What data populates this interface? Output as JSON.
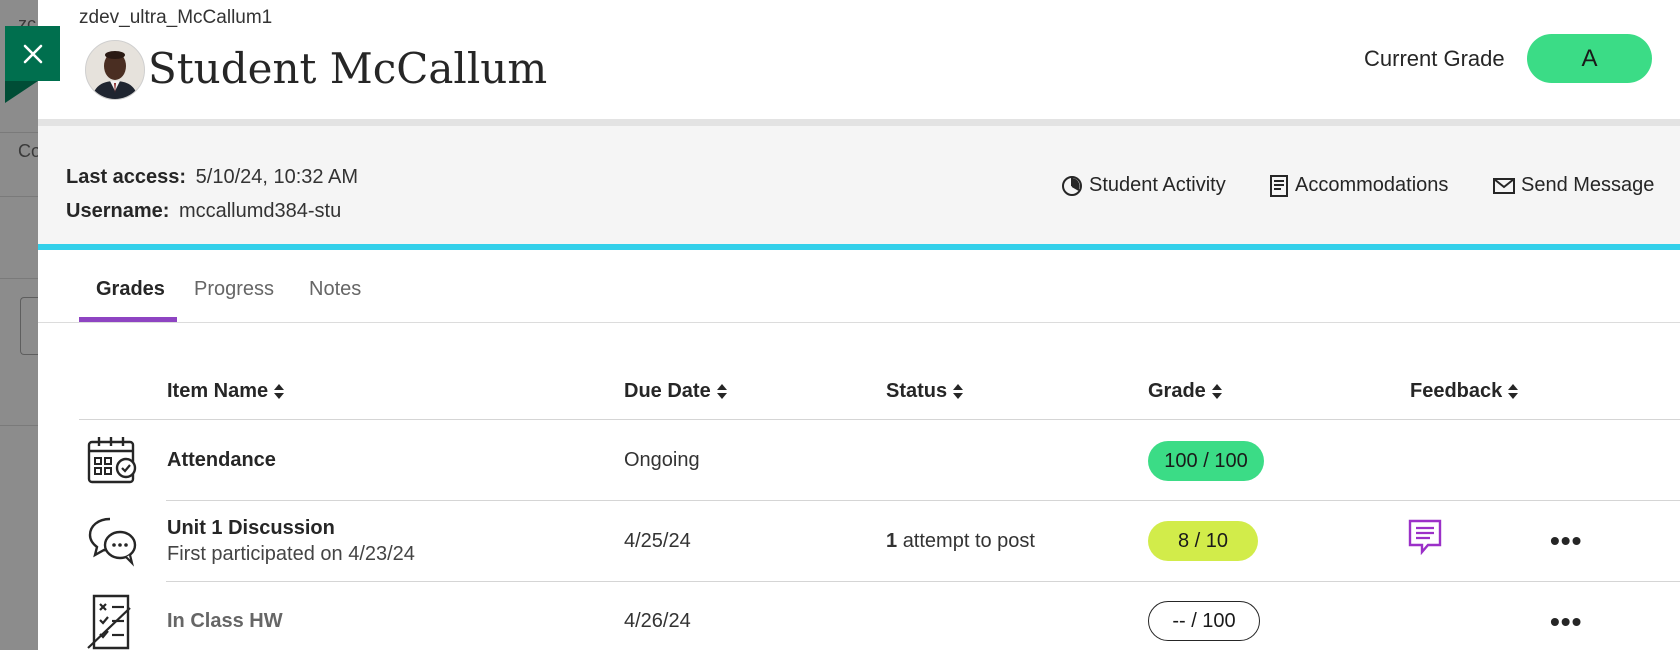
{
  "background": {
    "fragment_top": "zc",
    "fragment_mid": "Co"
  },
  "header": {
    "course_id": "zdev_ultra_McCallum1",
    "student_name": "Student McCallum",
    "current_grade_label": "Current Grade",
    "current_grade": "A"
  },
  "info": {
    "last_access_label": "Last access:",
    "last_access_value": "5/10/24, 10:32 AM",
    "username_label": "Username:",
    "username_value": "mccallumd384-stu"
  },
  "actions": {
    "student_activity": "Student Activity",
    "accommodations": "Accommodations",
    "send_message": "Send Message"
  },
  "tabs": {
    "grades": "Grades",
    "progress": "Progress",
    "notes": "Notes"
  },
  "columns": {
    "item_name": "Item Name",
    "due_date": "Due Date",
    "status": "Status",
    "grade": "Grade",
    "feedback": "Feedback"
  },
  "rows": [
    {
      "title": "Attendance",
      "subtitle": "",
      "due": "Ongoing",
      "status_count": "",
      "status_text": "",
      "grade": "100 / 100",
      "grade_color": "#3bdc86"
    },
    {
      "title": "Unit 1 Discussion",
      "subtitle": "First participated on 4/23/24",
      "due": "4/25/24",
      "status_count": "1",
      "status_text": "attempt to post",
      "grade": "8 / 10",
      "grade_color": "#d2ec4a"
    },
    {
      "title": "In Class HW",
      "subtitle": "",
      "due": "4/26/24",
      "status_count": "",
      "status_text": "",
      "grade": "-- / 100",
      "grade_color": "#ffffff"
    }
  ],
  "colors": {
    "accent_green": "#006f4e",
    "tab_underline": "#8e44c2",
    "info_border": "#33d0ea",
    "feedback_icon": "#9b30c8"
  }
}
